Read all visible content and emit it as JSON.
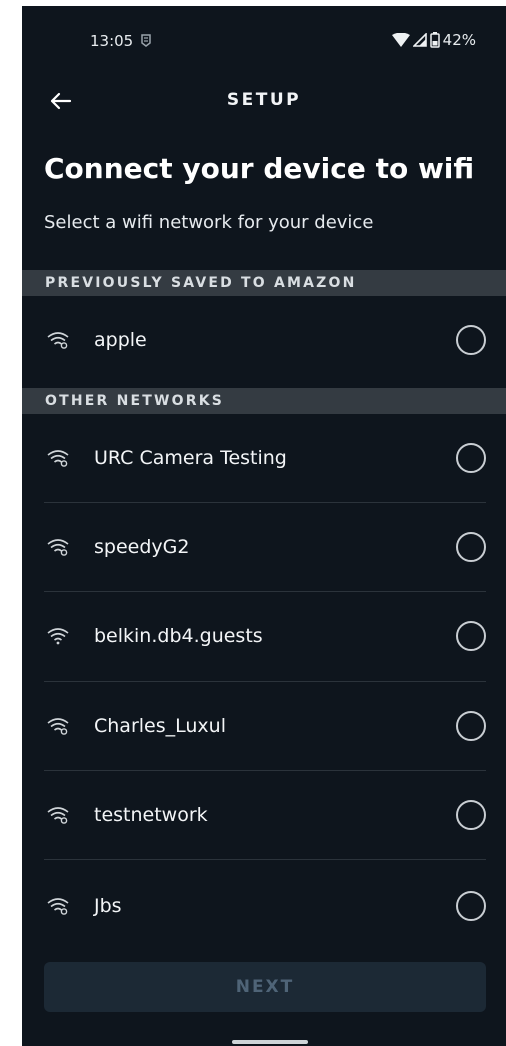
{
  "status_bar": {
    "time": "13:05",
    "battery": "42%",
    "icons": [
      "app-notification-icon",
      "wifi-signal-icon",
      "cell-signal-icon",
      "battery-icon"
    ]
  },
  "header": {
    "title": "SETUP",
    "back_icon": "arrow-left-icon"
  },
  "page": {
    "title": "Connect your device to wifi",
    "subtitle": "Select a wifi network for your device"
  },
  "sections": {
    "saved_header": "PREVIOUSLY SAVED TO AMAZON",
    "other_header": "OTHER NETWORKS"
  },
  "saved_networks": [
    {
      "name": "apple",
      "secured": true,
      "selected": false
    }
  ],
  "other_networks": [
    {
      "name": "URC Camera Testing",
      "secured": true,
      "selected": false
    },
    {
      "name": "speedyG2",
      "secured": true,
      "selected": false
    },
    {
      "name": "belkin.db4.guests",
      "secured": false,
      "selected": false
    },
    {
      "name": "Charles_Luxul",
      "secured": true,
      "selected": false
    },
    {
      "name": "testnetwork",
      "secured": true,
      "selected": false
    },
    {
      "name": "Jbs",
      "secured": true,
      "selected": false
    }
  ],
  "footer": {
    "next_label": "NEXT",
    "next_enabled": false
  },
  "colors": {
    "background": "#0e151d",
    "section_header_bg": "#343b42",
    "button_disabled_bg": "#1c2935",
    "button_disabled_text": "#4f6477"
  }
}
